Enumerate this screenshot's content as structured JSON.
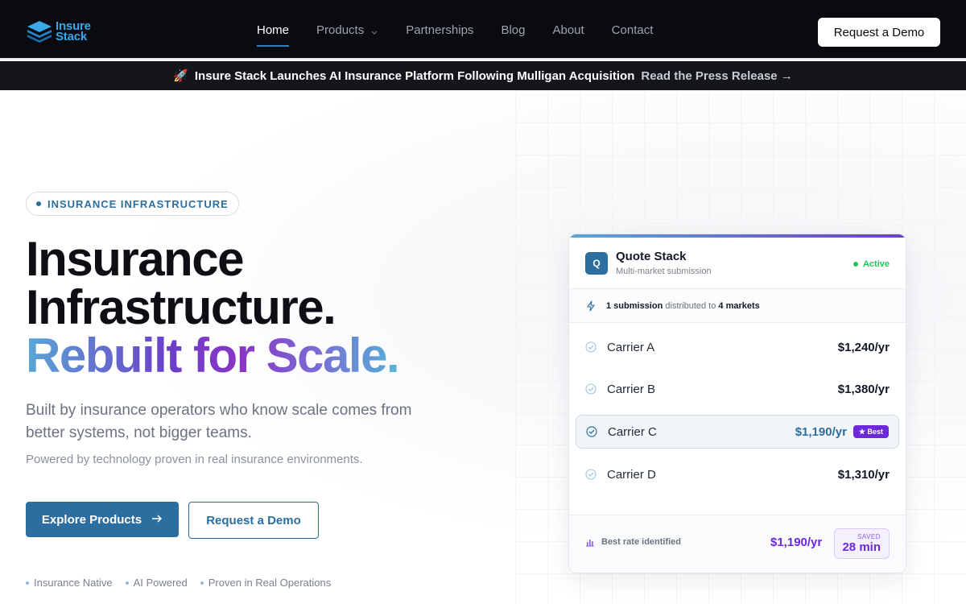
{
  "brand": {
    "line1": "Insure",
    "line2": "Stack"
  },
  "nav": {
    "links": [
      {
        "label": "Home",
        "active": true
      },
      {
        "label": "Products",
        "has_dropdown": true
      },
      {
        "label": "Partnerships"
      },
      {
        "label": "Blog"
      },
      {
        "label": "About"
      },
      {
        "label": "Contact"
      }
    ],
    "cta": "Request a Demo"
  },
  "announcement": {
    "icon": "rocket-emoji",
    "emoji": "🚀",
    "message": "Insure Stack Launches AI Insurance Platform Following Mulligan Acquisition",
    "link": "Read the Press Release →"
  },
  "hero": {
    "eyebrow": "INSURANCE INFRASTRUCTURE",
    "headline_line1": "Insurance",
    "headline_line2": "Infrastructure.",
    "headline_line3": "Rebuilt for Scale",
    "headline_dot": ".",
    "subheading": "Built by insurance operators who know scale comes from better systems, not bigger teams.",
    "subtext": "Powered by technology proven in real insurance environments.",
    "primary_button": "Explore Products",
    "secondary_button": "Request a Demo",
    "features": [
      "Insurance Native",
      "AI Powered",
      "Proven in Real Operations"
    ]
  },
  "card": {
    "badge": "Q",
    "title": "Quote Stack",
    "subtitle": "Multi-market submission",
    "status": "Active",
    "distribution": {
      "count": "1 submission",
      "middle": "distributed to",
      "markets": "4 markets"
    },
    "carriers": [
      {
        "name": "Carrier A",
        "price": "$1,240/yr"
      },
      {
        "name": "Carrier B",
        "price": "$1,380/yr"
      },
      {
        "name": "Carrier C",
        "price": "$1,190/yr",
        "best": true,
        "tag": "★ Best"
      },
      {
        "name": "Carrier D",
        "price": "$1,310/yr"
      }
    ],
    "footer": {
      "label": "Best rate identified",
      "price": "$1,190/yr",
      "saved_label": "SAVED",
      "saved_value": "28 min"
    }
  },
  "colors": {
    "nav_bg": "#0a0b10",
    "accent_blue": "#2c6e9f",
    "accent_purple": "#6d28d9",
    "status_green": "#22c55e"
  }
}
